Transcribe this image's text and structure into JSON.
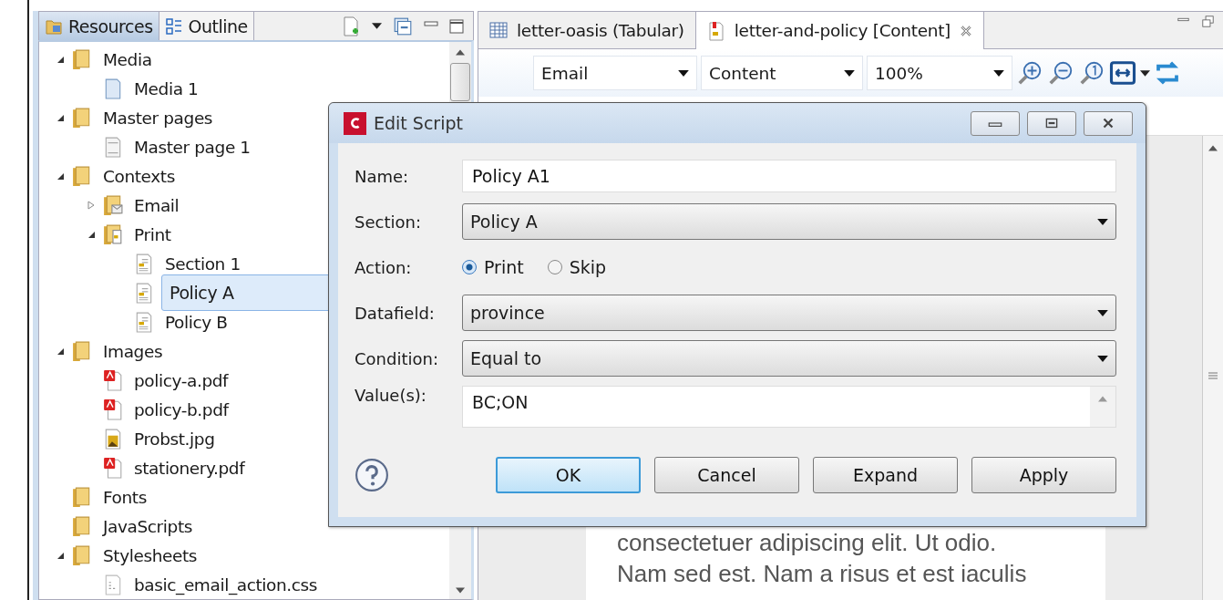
{
  "resources_panel": {
    "tabs": [
      {
        "label": "Resources",
        "selected": true
      },
      {
        "label": "Outline",
        "selected": false
      }
    ],
    "tree": [
      {
        "label": "Media",
        "kind": "folder",
        "expanded": true,
        "selected": false,
        "children": [
          {
            "label": "Media 1",
            "kind": "page",
            "selected": false
          }
        ]
      },
      {
        "label": "Master pages",
        "kind": "folder",
        "expanded": true,
        "selected": false,
        "children": [
          {
            "label": "Master page 1",
            "kind": "master",
            "selected": false
          }
        ]
      },
      {
        "label": "Contexts",
        "kind": "folder",
        "expanded": true,
        "selected": false,
        "children": [
          {
            "label": "Email",
            "kind": "email-folder",
            "expanded": false,
            "selected": false
          },
          {
            "label": "Print",
            "kind": "print-folder",
            "expanded": true,
            "selected": false,
            "children": [
              {
                "label": "Section 1",
                "kind": "section",
                "selected": false
              },
              {
                "label": "Policy A",
                "kind": "section",
                "selected": true
              },
              {
                "label": "Policy B",
                "kind": "section",
                "selected": false
              }
            ]
          }
        ]
      },
      {
        "label": "Images",
        "kind": "folder",
        "expanded": true,
        "selected": false,
        "children": [
          {
            "label": "policy-a.pdf",
            "kind": "pdf",
            "selected": false
          },
          {
            "label": "policy-b.pdf",
            "kind": "pdf",
            "selected": false
          },
          {
            "label": "Probst.jpg",
            "kind": "image",
            "selected": false
          },
          {
            "label": "stationery.pdf",
            "kind": "pdf",
            "selected": false
          }
        ]
      },
      {
        "label": "Fonts",
        "kind": "folder",
        "selected": false
      },
      {
        "label": "JavaScripts",
        "kind": "folder",
        "selected": false
      },
      {
        "label": "Stylesheets",
        "kind": "folder",
        "expanded": true,
        "selected": false,
        "children": [
          {
            "label": "basic_email_action.css",
            "kind": "css",
            "selected": false
          }
        ]
      }
    ]
  },
  "editor": {
    "tabs": [
      {
        "label": "letter-oasis (Tabular)",
        "kind": "table",
        "selected": false,
        "closable": false
      },
      {
        "label": "letter-and-policy [Content]",
        "kind": "document",
        "selected": true,
        "closable": true
      }
    ],
    "toolbar": {
      "dropdowns": [
        "Email",
        "Content",
        "100%"
      ]
    },
    "document_lines": [
      "consectetuer adipiscing elit. Ut odio.",
      "Nam sed est. Nam a risus et est iaculis"
    ]
  },
  "dialog": {
    "title": "Edit Script",
    "name_label": "Name:",
    "name_value": "Policy A1",
    "section_label": "Section:",
    "section_value": "Policy A",
    "action_label": "Action:",
    "action_options": [
      {
        "label": "Print",
        "selected": true
      },
      {
        "label": "Skip",
        "selected": false
      }
    ],
    "datafield_label": "Datafield:",
    "datafield_value": "province",
    "condition_label": "Condition:",
    "condition_value": "Equal to",
    "values_label": "Value(s):",
    "values_value": "BC;ON",
    "buttons": [
      {
        "label": "OK",
        "default": true
      },
      {
        "label": "Cancel",
        "default": false
      },
      {
        "label": "Expand",
        "default": false
      },
      {
        "label": "Apply",
        "default": false
      }
    ]
  }
}
